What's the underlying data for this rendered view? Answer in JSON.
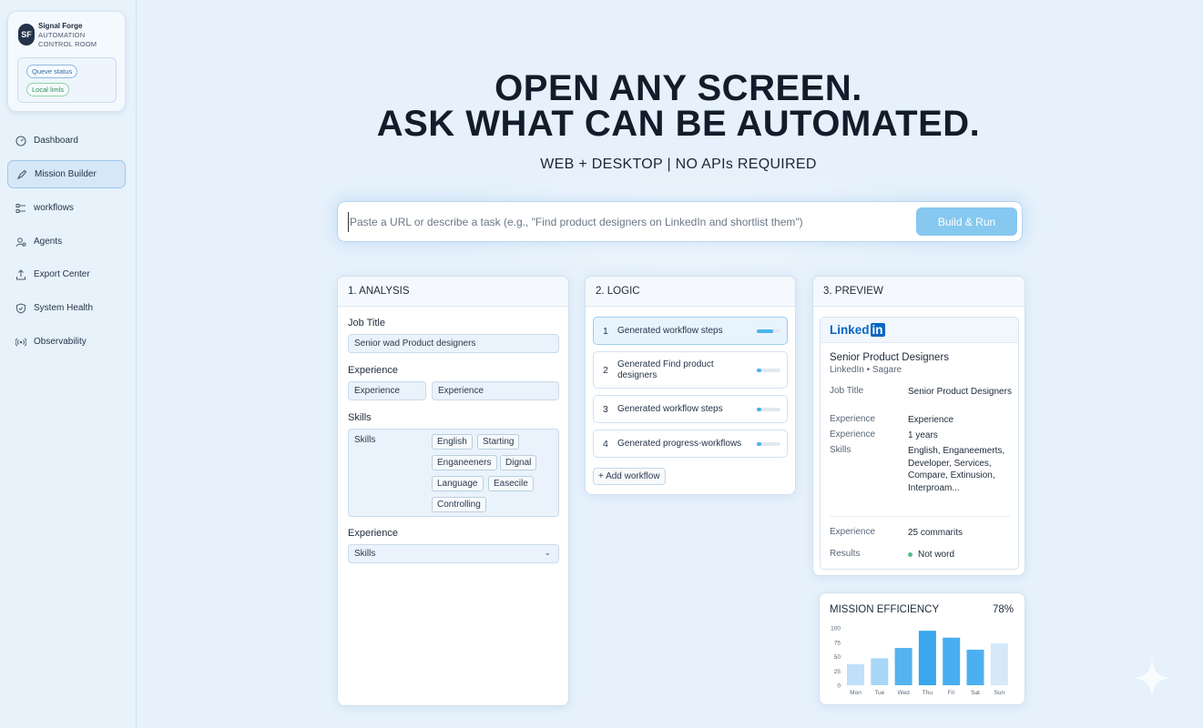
{
  "brand": {
    "logo": "SF",
    "name": "Signal Forge",
    "subtitle": "AUTOMATION CONTROL ROOM",
    "status_pills": [
      "Queve status",
      "Local limls"
    ]
  },
  "sidebar": {
    "items": [
      {
        "label": "Dashboard",
        "icon": "dashboard-icon"
      },
      {
        "label": "Mission Builder",
        "icon": "rocket-icon",
        "active": true
      },
      {
        "label": "workflows",
        "icon": "workflow-icon"
      },
      {
        "label": "Agents",
        "icon": "agents-icon"
      },
      {
        "label": "Export Center",
        "icon": "export-icon"
      },
      {
        "label": "System Health",
        "icon": "shield-icon"
      },
      {
        "label": "Observability",
        "icon": "signal-icon"
      }
    ]
  },
  "hero": {
    "title_line1": "OPEN ANY SCREEN.",
    "title_line2": "ASK WHAT CAN BE AUTOMATED.",
    "subtitle": "WEB + DESKTOP | NO APIs REQUIRED"
  },
  "search": {
    "placeholder": "Paste a URL or describe a task (e.g., \"Find product designers on LinkedIn and shortlist them\")",
    "value": "",
    "button": "Build & Run"
  },
  "analysis": {
    "title": "1. ANALYSIS",
    "job_title_label": "Job Title",
    "job_title_value": "Senior wad Product designers",
    "experience_label": "Experience",
    "experience_field_1": "Experience",
    "experience_field_2": "Experience",
    "skills_label": "Skills",
    "skills_box_label": "Skills",
    "skills_chips": [
      "English",
      "Starting",
      "Enganeeners",
      "Dignal",
      "Language",
      "Easecile",
      "Controlling"
    ],
    "experience_label_2": "Experience",
    "select_value": "Skills"
  },
  "logic": {
    "title": "2. LOGIC",
    "steps": [
      {
        "num": "1",
        "text": "Generated workflow steps",
        "progress": 0.7,
        "active": true
      },
      {
        "num": "2",
        "text": "Generated Find product designers",
        "progress": 0.2
      },
      {
        "num": "3",
        "text": "Generated workflow steps",
        "progress": 0.2
      },
      {
        "num": "4",
        "text": "Generated progress-workflows",
        "progress": 0.2
      }
    ],
    "add_button": "+ Add workflow"
  },
  "preview": {
    "title": "3. PREVIEW",
    "logo_text": "Linked",
    "logo_box": "in",
    "job_title": "Senior Product Designers",
    "company_line": "LinkedIn • Sagare",
    "rows": [
      {
        "key": "Job Title",
        "value": "Senior Product Designers"
      },
      {
        "key": "Experience",
        "value": "Experience"
      },
      {
        "key": "Experience",
        "value": "1 years"
      },
      {
        "key": "Skills",
        "value": "English, Enganeemerts, Developer, Services, Compare, Extinusion, Interproam..."
      }
    ],
    "footer_rows": [
      {
        "key": "Experience",
        "value": "25 commarits"
      },
      {
        "key": "Results",
        "value": "Not word"
      }
    ]
  },
  "efficiency": {
    "title": "MISSION EFFICIENCY",
    "percent": "78%"
  },
  "chart_data": {
    "type": "bar",
    "categories": [
      "Mon",
      "Tue",
      "Wed",
      "Thu",
      "Fri",
      "Sat",
      "Sun"
    ],
    "values": [
      37,
      47,
      65,
      95,
      83,
      62,
      73
    ],
    "yticks": [
      0,
      25,
      50,
      75,
      100
    ],
    "ylim": [
      0,
      100
    ],
    "colors": [
      "#bfe0f8",
      "#a9d6f6",
      "#55b3ee",
      "#3aa6ee",
      "#49aef0",
      "#4cb0f0",
      "#d5e9f9"
    ]
  }
}
